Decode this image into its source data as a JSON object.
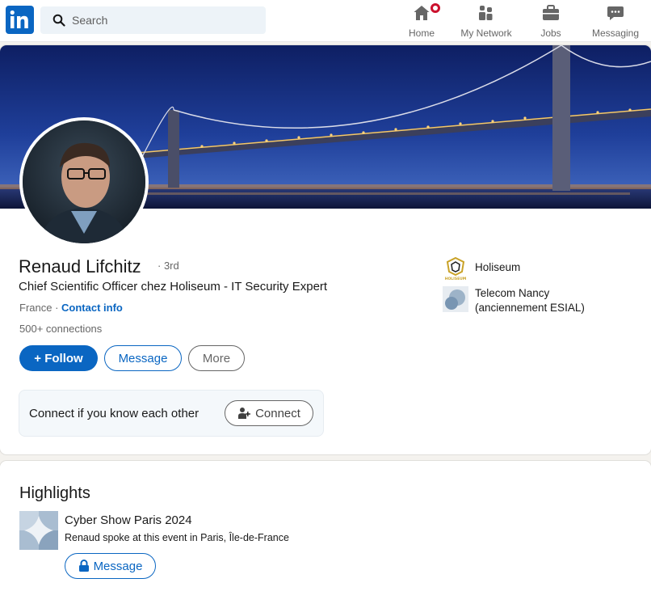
{
  "nav": {
    "search_placeholder": "Search",
    "items": [
      {
        "label": "Home",
        "icon": "home-icon"
      },
      {
        "label": "My Network",
        "icon": "network-icon"
      },
      {
        "label": "Jobs",
        "icon": "briefcase-icon"
      },
      {
        "label": "Messaging",
        "icon": "messaging-icon"
      }
    ]
  },
  "profile": {
    "name": "Renaud Lifchitz",
    "degree": "· 3rd",
    "headline": "Chief Scientific Officer chez Holiseum - IT Security Expert",
    "location": "France",
    "separator": " · ",
    "contact_info": "Contact info",
    "connections": "500+ connections",
    "follow_label": "+ Follow",
    "message_label": "Message",
    "more_label": "More",
    "connect_prompt": "Connect if you know each other",
    "connect_label": "Connect",
    "organizations": [
      {
        "name": "Holiseum",
        "logo_text": "HOLISEUM"
      },
      {
        "name": "Telecom Nancy (anciennement ESIAL)"
      }
    ]
  },
  "highlights": {
    "title": "Highlights",
    "event_title": "Cyber Show Paris 2024",
    "event_desc": "Renaud spoke at this event in Paris, Île-de-France",
    "message_label": "Message"
  },
  "colors": {
    "brand": "#0a66c2",
    "notification": "#cb112d",
    "page_bg": "#f4f2ee"
  }
}
